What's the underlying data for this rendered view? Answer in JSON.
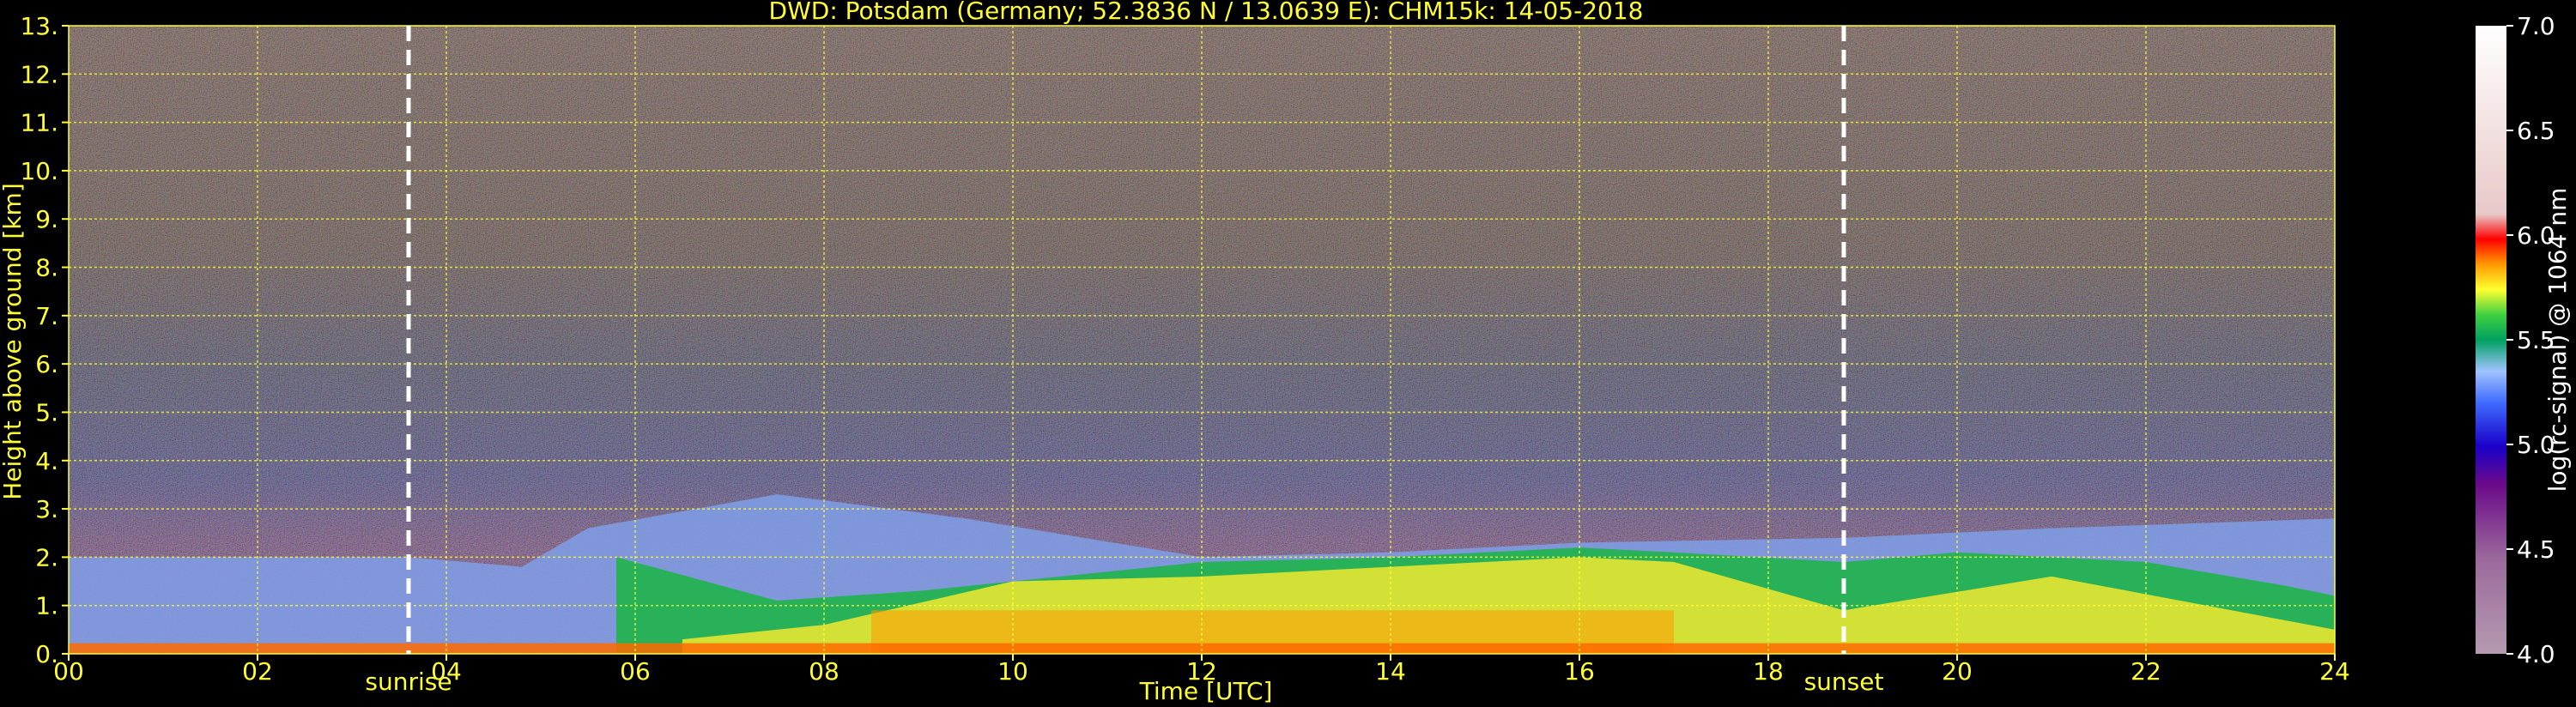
{
  "chart_data": {
    "type": "heatmap",
    "title": "DWD: Potsdam (Germany; 52.3836 N / 13.0639 E):    CHM15k: 14-05-2018",
    "xlabel": "Time [UTC]",
    "ylabel": "Height above ground [km]",
    "x_ticks": [
      "00",
      "02",
      "04",
      "06",
      "08",
      "10",
      "12",
      "14",
      "16",
      "18",
      "20",
      "22",
      "24"
    ],
    "y_ticks": [
      "0.",
      "1.",
      "2.",
      "3.",
      "4.",
      "5.",
      "6.",
      "7.",
      "8.",
      "9.",
      "10.",
      "11.",
      "12.",
      "13."
    ],
    "xlim": [
      0,
      24
    ],
    "ylim": [
      0,
      13
    ],
    "grid": true,
    "colorbar": {
      "label": "log(rc-signal) @ 1064 nm",
      "range": [
        4.0,
        7.0
      ],
      "ticks": [
        "4.0",
        "4.5",
        "5.0",
        "5.5",
        "6.0",
        "6.5",
        "7.0"
      ]
    },
    "annotations": [
      {
        "label": "sunrise",
        "x": 3.6
      },
      {
        "label": "sunset",
        "x": 18.8
      }
    ],
    "layers": [
      {
        "kind": "background-noise",
        "y_from": 0,
        "y_to": 13
      },
      {
        "kind": "boundary-layer-top",
        "points": [
          [
            0,
            2.0
          ],
          [
            3.6,
            2.0
          ],
          [
            4.8,
            1.8
          ],
          [
            5.5,
            2.6
          ],
          [
            7.5,
            3.3
          ],
          [
            9.5,
            2.8
          ],
          [
            12,
            2.0
          ],
          [
            14,
            2.1
          ],
          [
            16,
            2.3
          ],
          [
            18.8,
            2.4
          ],
          [
            21,
            2.6
          ],
          [
            24,
            2.8
          ]
        ]
      },
      {
        "kind": "aerosol-core",
        "points": [
          [
            6.5,
            0.3
          ],
          [
            8,
            0.6
          ],
          [
            10,
            1.5
          ],
          [
            12,
            1.6
          ],
          [
            14,
            1.8
          ],
          [
            16,
            2.0
          ],
          [
            17,
            1.9
          ],
          [
            18.8,
            0.9
          ],
          [
            21,
            1.6
          ],
          [
            24,
            0.5
          ]
        ]
      }
    ]
  }
}
